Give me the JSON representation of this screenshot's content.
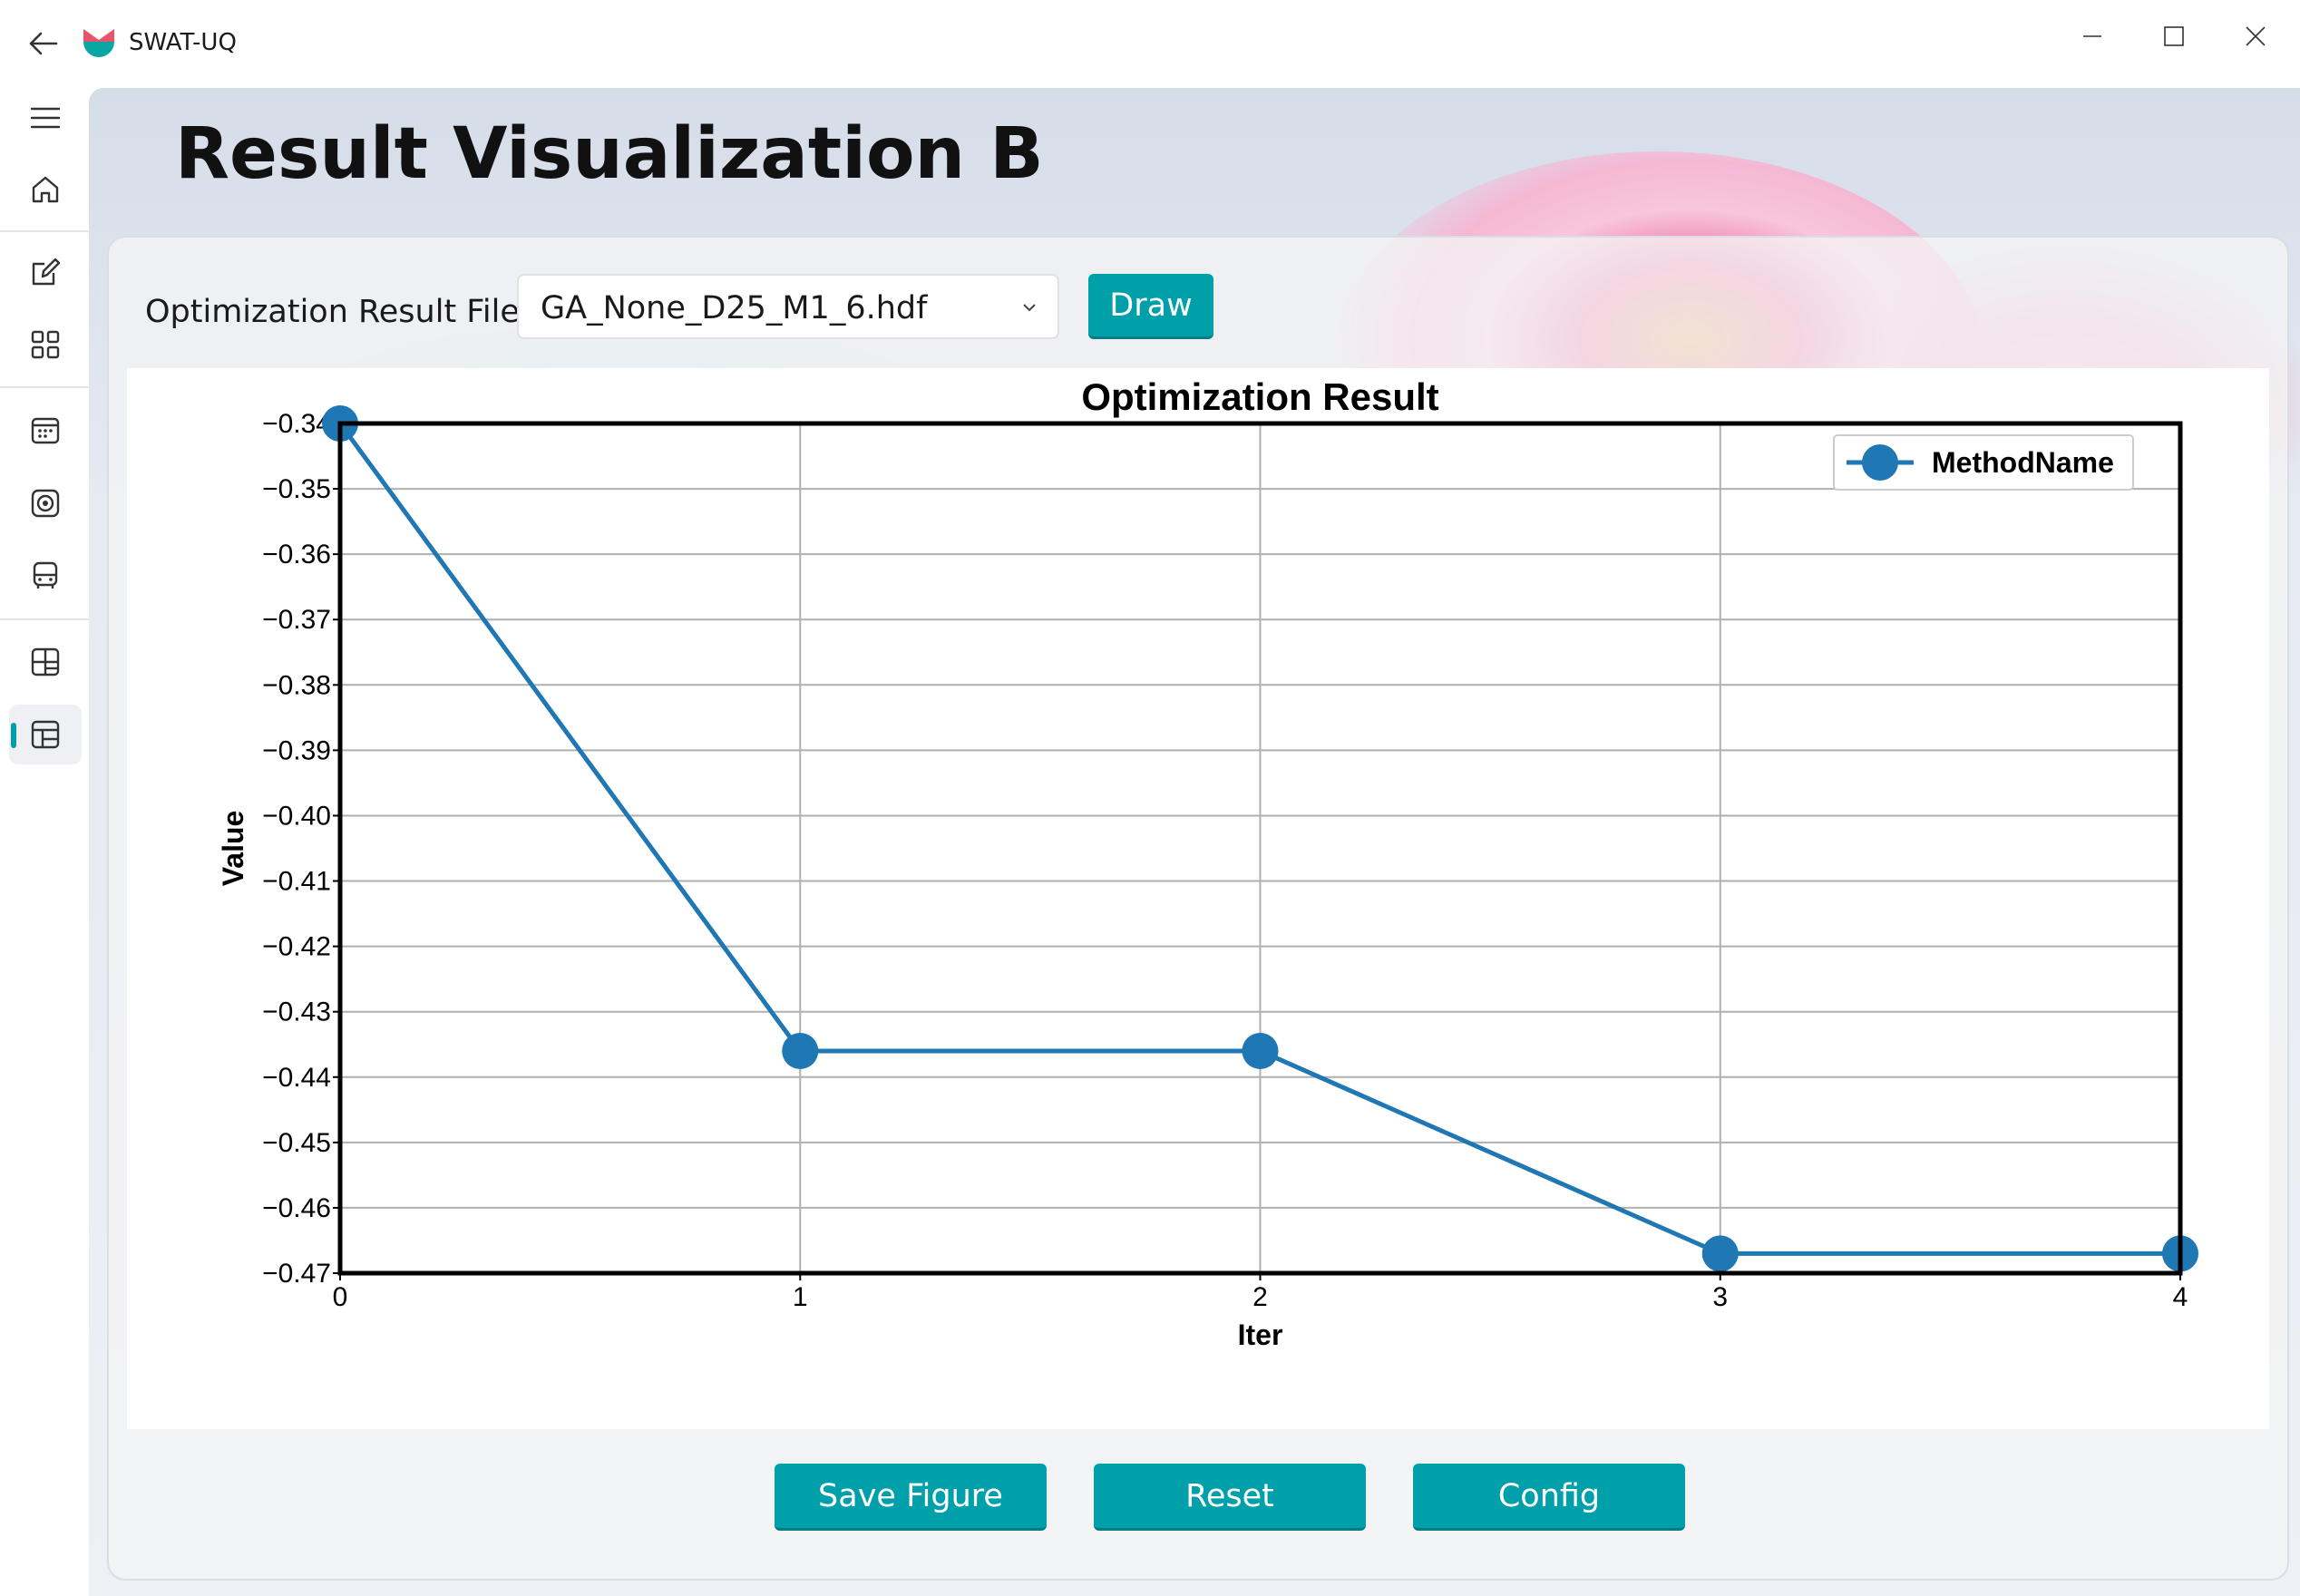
{
  "window": {
    "title": "SWAT-UQ",
    "controls": [
      "minimize-icon",
      "maximize-icon",
      "close-icon"
    ]
  },
  "nav": {
    "items": [
      {
        "icon": "hamburger-menu-icon"
      },
      {
        "icon": "home-icon"
      },
      {
        "icon": "edit-icon"
      },
      {
        "icon": "apps-grid-icon"
      },
      {
        "icon": "calendar-icon"
      },
      {
        "icon": "target-icon"
      },
      {
        "icon": "bus-icon"
      },
      {
        "icon": "layout-table-icon"
      },
      {
        "icon": "layout-table-icon",
        "active": true
      }
    ],
    "accent_color": "#009faa"
  },
  "page": {
    "title": "Result Visualization B"
  },
  "controls": {
    "file_label": "Optimization Result File:",
    "file_value": "GA_None_D25_M1_6.hdf",
    "draw_label": "Draw"
  },
  "footer_buttons": {
    "save_label": "Save Figure",
    "reset_label": "Reset",
    "config_label": "Config"
  },
  "chart_data": {
    "type": "line",
    "title": "Optimization Result",
    "xlabel": "Iter",
    "ylabel": "Value",
    "x": [
      0,
      1,
      2,
      3,
      4
    ],
    "x_ticks": [
      "0",
      "1",
      "2",
      "3",
      "4"
    ],
    "xlim": [
      0,
      4
    ],
    "ylim": [
      -0.47,
      -0.34
    ],
    "y_ticks": [
      "−0.34",
      "−0.35",
      "−0.36",
      "−0.37",
      "−0.38",
      "−0.39",
      "−0.40",
      "−0.41",
      "−0.42",
      "−0.43",
      "−0.44",
      "−0.45",
      "−0.46",
      "−0.47"
    ],
    "y_tick_values": [
      -0.34,
      -0.35,
      -0.36,
      -0.37,
      -0.38,
      -0.39,
      -0.4,
      -0.41,
      -0.42,
      -0.43,
      -0.44,
      -0.45,
      -0.46,
      -0.47
    ],
    "series": [
      {
        "name": "MethodName",
        "values": [
          -0.34,
          -0.436,
          -0.436,
          -0.467,
          -0.467
        ],
        "color": "#1f77b4",
        "marker": "circle"
      }
    ],
    "grid": true,
    "legend": "top-right"
  },
  "colors": {
    "accent": "#00a0aa",
    "series": "#1f77b4"
  }
}
